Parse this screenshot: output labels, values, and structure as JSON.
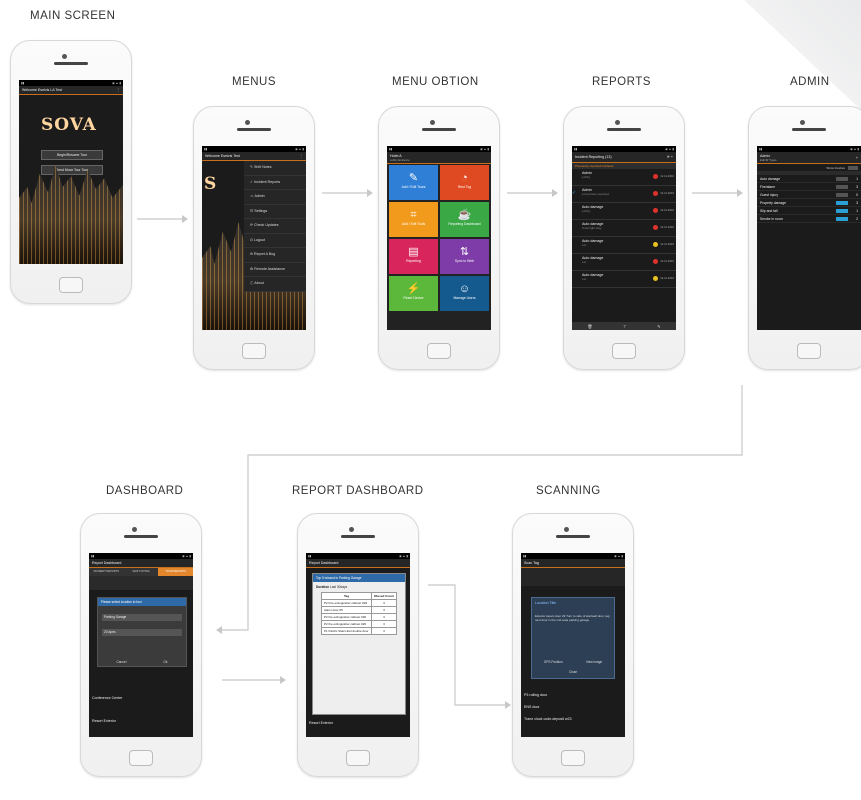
{
  "stages": [
    {
      "label": "MAIN SCREEN"
    },
    {
      "label": "MENUS"
    },
    {
      "label": "MENU OBTION"
    },
    {
      "label": "REPORTS"
    },
    {
      "label": "ADMIN"
    },
    {
      "label": "DASHBOARD"
    },
    {
      "label": "REPORT DASHBOARD"
    },
    {
      "label": "SCANNING"
    }
  ],
  "main_screen": {
    "title": "Welcome Eseivis LA Test",
    "logo": "SOVA",
    "buttons": [
      "Begin/Resume Tour",
      "Send Move Tour Tour"
    ]
  },
  "menus": {
    "title": "Welcome Eseivis Test",
    "items": [
      "Shift Notes",
      "Incident Reports",
      "Admin",
      "Settings",
      "Check Updates",
      "Logout",
      "Report A Bug",
      "Remote Assistance",
      "About"
    ]
  },
  "menu_option": {
    "title": "Hotel A",
    "subtitle": "Lobby Entrance",
    "tiles": [
      {
        "label": "Add / Edit Tours",
        "color": "#2f7fd6",
        "icon": "pen-icon"
      },
      {
        "label": "Rest Tog",
        "color": "#e04a23",
        "icon": "pie-icon"
      },
      {
        "label": "Add / Edit Tools",
        "color": "#f19a1b",
        "icon": "crop-icon"
      },
      {
        "label": "Reporting Dashboard",
        "color": "#3aa845",
        "icon": "cup-icon"
      },
      {
        "label": "Reporting",
        "color": "#d8265c",
        "icon": "doc-icon"
      },
      {
        "label": "Sync to Web",
        "color": "#7d3ca8",
        "icon": "sync-icon"
      },
      {
        "label": "Reset Device",
        "color": "#5cb83a",
        "icon": "bolt-icon"
      },
      {
        "label": "Manage Users",
        "color": "#155a8f",
        "icon": "users-icon"
      }
    ]
  },
  "reports": {
    "title": "Incident Reporting (13)",
    "banner": "Previously reported incidents",
    "rows": [
      {
        "title": "Admin",
        "sub": "Lobby",
        "status": "#e0322b",
        "date": "12.11.2016"
      },
      {
        "title": "Admin",
        "sub": "Lost phone reported",
        "status": "#e0322b",
        "date": "12.11.2016",
        "checked": true
      },
      {
        "title": "Auto damage",
        "sub": "Lobby",
        "status": "#e0322b",
        "date": "12.11.2016"
      },
      {
        "title": "Auto damage",
        "sub": "Overnight stay",
        "status": "#e0322b",
        "date": "12.11.2016"
      },
      {
        "title": "Auto damage",
        "sub": "Lot",
        "status": "#e8c21e",
        "date": "12.11.2016"
      },
      {
        "title": "Auto damage",
        "sub": "Lot",
        "status": "#e0322b",
        "date": "12.11.2016"
      },
      {
        "title": "Auto damage",
        "sub": "Lot",
        "status": "#e8c21e",
        "date": "12.11.2016"
      }
    ]
  },
  "admin": {
    "title": "Admin",
    "subtitle": "Edit IR Types",
    "filter_label": "Show Inactive",
    "rows": [
      {
        "name": "Auto damage",
        "active": false,
        "count": "1"
      },
      {
        "name": "Fire/alarm",
        "active": false,
        "count": "3"
      },
      {
        "name": "Guest injury",
        "active": false,
        "count": "0"
      },
      {
        "name": "Property damage",
        "active": true,
        "count": "3"
      },
      {
        "name": "Slip and fall",
        "active": true,
        "count": "1"
      },
      {
        "name": "Smoke in room",
        "active": true,
        "count": "2"
      }
    ]
  },
  "dashboard": {
    "title": "Report Dashboard",
    "tabs": [
      "INCIDENT REPORTS",
      "SHIFT NOTES",
      "TOUR REPORTS"
    ],
    "dialog_title": "Please select location to tour",
    "fields": [
      "Parking Garage",
      "20 Apes"
    ],
    "actions": [
      "Cancel",
      "Ok"
    ],
    "section1": "Conference Center",
    "section2": "Resort Exterior"
  },
  "report_dashboard": {
    "title": "Report Dashboard",
    "dialog_title": "Top 5 missed in Parking Garage",
    "duration_label": "Duration",
    "duration_value": "Last 30days",
    "table_headers": [
      "Tag",
      "Missed Count"
    ],
    "table_rows": [
      [
        "P2 Fire extinguisher cabinet 029",
        "3"
      ],
      [
        "Alarm door 05",
        "3"
      ],
      [
        "P2 fire extinguisher cabinet 036",
        "3"
      ],
      [
        "P2 fire extinguisher cabinet 026",
        "3"
      ],
      [
        "P1 Pacific Stairs Exit double door",
        "3"
      ]
    ],
    "footer": "Resort Exterior"
  },
  "scanning": {
    "title": "Scan Tag",
    "location_title": "Location Title",
    "text": "Exterior steam door 29 Turn to side of stairwell door, tag next door in the mid area parking garage.",
    "actions": [
      "GPS Position",
      "New image"
    ],
    "close": "Close",
    "list": [
      "P3 rolling door",
      "ENS door",
      "Trane clock code-deposit w23"
    ]
  }
}
